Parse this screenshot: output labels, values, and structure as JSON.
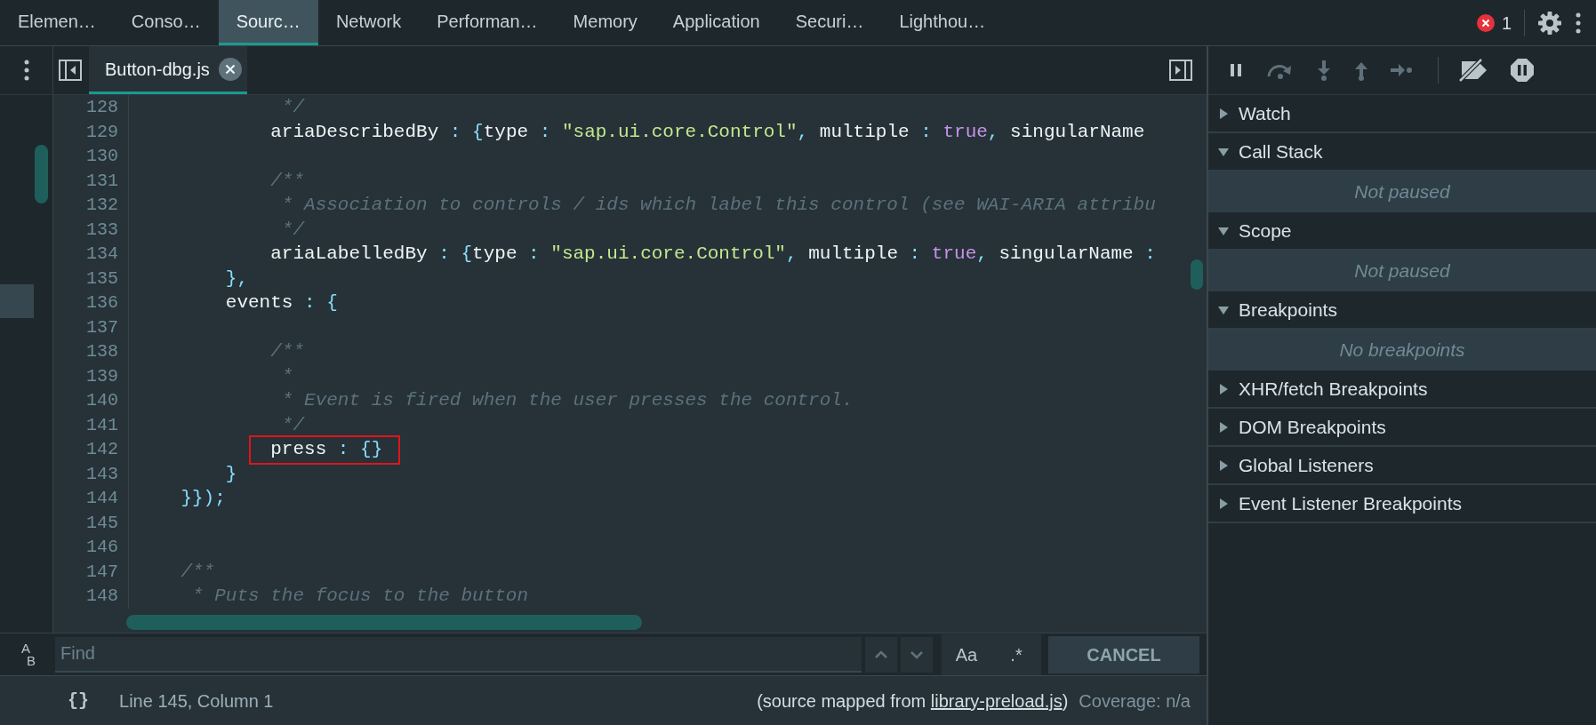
{
  "top_tabs": [
    {
      "label": "Elemen…",
      "selected": false
    },
    {
      "label": "Conso…",
      "selected": false
    },
    {
      "label": "Sourc…",
      "selected": true
    },
    {
      "label": "Network",
      "selected": false
    },
    {
      "label": "Performan…",
      "selected": false
    },
    {
      "label": "Memory",
      "selected": false
    },
    {
      "label": "Application",
      "selected": false
    },
    {
      "label": "Securi…",
      "selected": false
    },
    {
      "label": "Lighthou…",
      "selected": false
    }
  ],
  "error_count": "1",
  "file_tabs": [
    {
      "label": "Button-dbg.js",
      "selected": true
    }
  ],
  "code_lines": [
    {
      "number": "128",
      "highlighted": false,
      "tokens": [
        {
          "kind": "comment",
          "text": "             */"
        }
      ]
    },
    {
      "number": "129",
      "highlighted": false,
      "tokens": [
        {
          "kind": "plain",
          "text": "            ariaDescribedBy"
        },
        {
          "kind": "punct",
          "text": " : {"
        },
        {
          "kind": "plain",
          "text": "type"
        },
        {
          "kind": "punct",
          "text": " : "
        },
        {
          "kind": "string",
          "text": "\"sap.ui.core.Control\""
        },
        {
          "kind": "punct",
          "text": ", "
        },
        {
          "kind": "plain",
          "text": "multiple"
        },
        {
          "kind": "punct",
          "text": " : "
        },
        {
          "kind": "keyword",
          "text": "true"
        },
        {
          "kind": "punct",
          "text": ", "
        },
        {
          "kind": "plain",
          "text": "singularName"
        }
      ]
    },
    {
      "number": "130",
      "highlighted": false
    },
    {
      "number": "131",
      "highlighted": false,
      "tokens": [
        {
          "kind": "comment",
          "text": "            /**"
        }
      ]
    },
    {
      "number": "132",
      "highlighted": false,
      "tokens": [
        {
          "kind": "comment",
          "text": "             * Association to controls / ids which label this control (see WAI-ARIA attribu"
        }
      ]
    },
    {
      "number": "133",
      "highlighted": false,
      "tokens": [
        {
          "kind": "comment",
          "text": "             */"
        }
      ]
    },
    {
      "number": "134",
      "highlighted": false,
      "tokens": [
        {
          "kind": "plain",
          "text": "            ariaLabelledBy"
        },
        {
          "kind": "punct",
          "text": " : {"
        },
        {
          "kind": "plain",
          "text": "type"
        },
        {
          "kind": "punct",
          "text": " : "
        },
        {
          "kind": "string",
          "text": "\"sap.ui.core.Control\""
        },
        {
          "kind": "punct",
          "text": ", "
        },
        {
          "kind": "plain",
          "text": "multiple"
        },
        {
          "kind": "punct",
          "text": " : "
        },
        {
          "kind": "keyword",
          "text": "true"
        },
        {
          "kind": "punct",
          "text": ", "
        },
        {
          "kind": "plain",
          "text": "singularName"
        },
        {
          "kind": "punct",
          "text": " :"
        }
      ]
    },
    {
      "number": "135",
      "highlighted": false,
      "tokens": [
        {
          "kind": "punct",
          "text": "        },"
        }
      ]
    },
    {
      "number": "136",
      "highlighted": false,
      "tokens": [
        {
          "kind": "plain",
          "text": "        events"
        },
        {
          "kind": "punct",
          "text": " : {"
        }
      ]
    },
    {
      "number": "137",
      "highlighted": false
    },
    {
      "number": "138",
      "highlighted": false,
      "tokens": [
        {
          "kind": "comment",
          "text": "            /**"
        }
      ]
    },
    {
      "number": "139",
      "highlighted": false,
      "tokens": [
        {
          "kind": "comment",
          "text": "             *"
        }
      ]
    },
    {
      "number": "140",
      "highlighted": false,
      "tokens": [
        {
          "kind": "comment",
          "text": "             * Event is fired when the user presses the control."
        }
      ]
    },
    {
      "number": "141",
      "highlighted": false,
      "tokens": [
        {
          "kind": "comment",
          "text": "             */"
        }
      ]
    },
    {
      "number": "142",
      "highlighted": true,
      "tokens": [
        {
          "kind": "plain",
          "text": "            press"
        },
        {
          "kind": "punct",
          "text": " : {}"
        }
      ]
    },
    {
      "number": "143",
      "highlighted": false,
      "tokens": [
        {
          "kind": "punct",
          "text": "        }"
        }
      ]
    },
    {
      "number": "144",
      "highlighted": false,
      "tokens": [
        {
          "kind": "punct",
          "text": "    }});"
        }
      ]
    },
    {
      "number": "145",
      "highlighted": false
    },
    {
      "number": "146",
      "highlighted": false
    },
    {
      "number": "147",
      "highlighted": false,
      "tokens": [
        {
          "kind": "comment",
          "text": "    /**"
        }
      ]
    },
    {
      "number": "148",
      "highlighted": false,
      "tokens": [
        {
          "kind": "comment",
          "text": "     * Puts the focus to the button"
        }
      ]
    }
  ],
  "debugger_sections": [
    {
      "title": "Watch",
      "expanded": false
    },
    {
      "title": "Call Stack",
      "expanded": true,
      "message": "Not paused"
    },
    {
      "title": "Scope",
      "expanded": true,
      "message": "Not paused"
    },
    {
      "title": "Breakpoints",
      "expanded": true,
      "message": "No breakpoints"
    },
    {
      "title": "XHR/fetch Breakpoints",
      "expanded": false
    },
    {
      "title": "DOM Breakpoints",
      "expanded": false
    },
    {
      "title": "Global Listeners",
      "expanded": false
    },
    {
      "title": "Event Listener Breakpoints",
      "expanded": false
    }
  ],
  "find_bar": {
    "replace_toggle": [
      "A",
      "B"
    ],
    "placeholder": "Find",
    "options": [
      "Aa",
      ".*"
    ],
    "cancel": "CANCEL"
  },
  "status_bar": {
    "format_button": "{}",
    "position": "Line 145, Column 1",
    "source_map_before": "(source mapped from ",
    "source_map_link": "library-preload.js",
    "source_map_after": ")",
    "coverage": "Coverage: n/a"
  }
}
